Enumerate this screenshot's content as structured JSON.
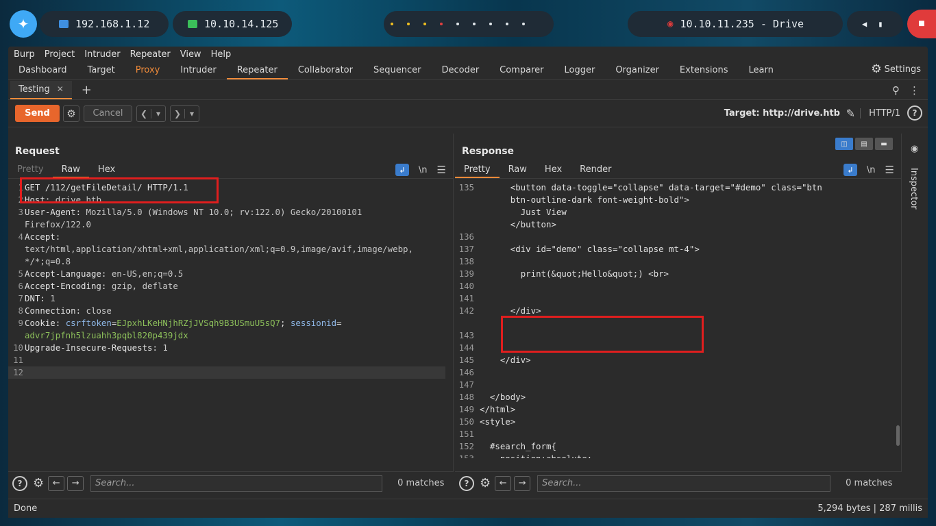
{
  "taskbar": {
    "ip_local": "192.168.1.12",
    "ip_vpn": "10.10.14.125",
    "target": "10.10.11.235 - Drive"
  },
  "menu": [
    "Burp",
    "Project",
    "Intruder",
    "Repeater",
    "View",
    "Help"
  ],
  "tabs": [
    "Dashboard",
    "Target",
    "Proxy",
    "Intruder",
    "Repeater",
    "Collaborator",
    "Sequencer",
    "Decoder",
    "Comparer",
    "Logger",
    "Organizer",
    "Extensions",
    "Learn"
  ],
  "settings_label": "Settings",
  "subtab": {
    "label": "Testing"
  },
  "toolbar": {
    "send": "Send",
    "cancel": "Cancel",
    "target": "Target: http://drive.htb",
    "http": "HTTP/1"
  },
  "request": {
    "title": "Request",
    "tabs": [
      "Pretty",
      "Raw",
      "Hex"
    ],
    "newline": "\\n",
    "lines": [
      {
        "n": "1",
        "k": "GET /112/getFileDetail/ HTTP/1.1",
        "v": ""
      },
      {
        "n": "2",
        "k": "Host:",
        "v": " drive.htb"
      },
      {
        "n": "3",
        "k": "User-Agent:",
        "v": " Mozilla/5.0 (Windows NT 10.0; rv:122.0) Gecko/20100101\nFirefox/122.0"
      },
      {
        "n": "4",
        "k": "Accept:",
        "v": "\ntext/html,application/xhtml+xml,application/xml;q=0.9,image/avif,image/webp,\n*/*;q=0.8"
      },
      {
        "n": "5",
        "k": "Accept-Language:",
        "v": " en-US,en;q=0.5"
      },
      {
        "n": "6",
        "k": "Accept-Encoding:",
        "v": " gzip, deflate"
      },
      {
        "n": "7",
        "k": "DNT:",
        "v": " 1"
      },
      {
        "n": "8",
        "k": "Connection:",
        "v": " close"
      },
      {
        "n": "9",
        "k": "Cookie:",
        "v": ""
      },
      {
        "n": "10",
        "k": "Upgrade-Insecure-Requests:",
        "v": " 1"
      },
      {
        "n": "11",
        "k": "",
        "v": ""
      },
      {
        "n": "12",
        "k": "",
        "v": ""
      }
    ],
    "cookie": {
      "k1": "csrftoken",
      "v1": "EJpxhLKeHNjhRZjJVSqh9B3USmuU5sQ7",
      "k2": "sessionid",
      "v2": "advr7jpfnh5lzuahh3pqbl820p439jdx"
    }
  },
  "response": {
    "title": "Response",
    "tabs": [
      "Pretty",
      "Raw",
      "Hex",
      "Render"
    ],
    "newline": "\\n",
    "lines": [
      {
        "n": "",
        "t": ""
      },
      {
        "n": "135",
        "t": "      <button data-toggle=\"collapse\" data-target=\"#demo\" class=\"btn\n      btn-outline-dark font-weight-bold\">\n        Just View\n      </button>"
      },
      {
        "n": "136",
        "t": ""
      },
      {
        "n": "137",
        "t": "      <div id=\"demo\" class=\"collapse mt-4\">"
      },
      {
        "n": "138",
        "t": ""
      },
      {
        "n": "139",
        "t": "        print(&quot;Hello&quot;) <br>"
      },
      {
        "n": "140",
        "t": ""
      },
      {
        "n": "141",
        "t": ""
      },
      {
        "n": "142",
        "t": "      </div>"
      },
      {
        "n": "",
        "t": ""
      },
      {
        "n": "143",
        "t": ""
      },
      {
        "n": "144",
        "t": ""
      },
      {
        "n": "145",
        "t": "    </div>"
      },
      {
        "n": "146",
        "t": ""
      },
      {
        "n": "147",
        "t": ""
      },
      {
        "n": "148",
        "t": "  </body>"
      },
      {
        "n": "149",
        "t": "</html>"
      },
      {
        "n": "150",
        "t": "<style>"
      },
      {
        "n": "151",
        "t": ""
      },
      {
        "n": "152",
        "t": "  #search_form{"
      },
      {
        "n": "153",
        "t": "    position:absolute;"
      }
    ]
  },
  "inspector": "Inspector",
  "search": {
    "placeholder": "Search...",
    "matches": "0 matches"
  },
  "status": {
    "left": "Done",
    "right": "5,294 bytes | 287 millis"
  }
}
